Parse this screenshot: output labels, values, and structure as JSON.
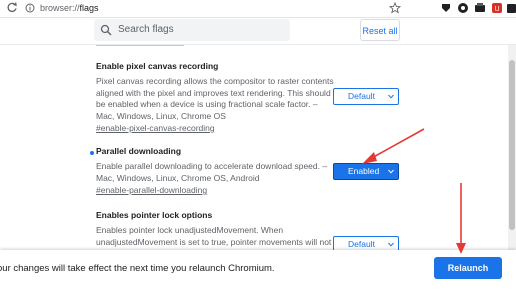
{
  "browser": {
    "url_scheme": "browser://",
    "url_path": "flags"
  },
  "header": {
    "search_placeholder": "Search flags",
    "reset_label": "Reset all"
  },
  "flags": [
    {
      "title": "Enable pixel canvas recording",
      "description": "Pixel canvas recording allows the compositor to raster contents aligned with the pixel and improves text rendering. This should be enabled when a device is using fractional scale factor. – Mac, Windows, Linux, Chrome OS",
      "anchor": "#enable-pixel-canvas-recording",
      "value": "Default"
    },
    {
      "title": "Parallel downloading",
      "description": "Enable parallel downloading to accelerate download speed. – Mac, Windows, Linux, Chrome OS, Android",
      "anchor": "#enable-parallel-downloading",
      "value": "Enabled"
    },
    {
      "title": "Enables pointer lock options",
      "description": "Enables pointer lock unadjustedMovement. When unadjustedMovement is set to true, pointer movements will not be",
      "anchor": "",
      "value": "Default"
    }
  ],
  "relaunch": {
    "message": "our changes will take effect the next time you relaunch Chromium.",
    "button_label": "Relaunch"
  },
  "colors": {
    "accent": "#1a73e8",
    "annotation_arrow": "#e53935"
  },
  "icons": [
    "refresh-icon",
    "site-info-icon",
    "extension-icon",
    "search-icon",
    "chevron-down-icon"
  ]
}
